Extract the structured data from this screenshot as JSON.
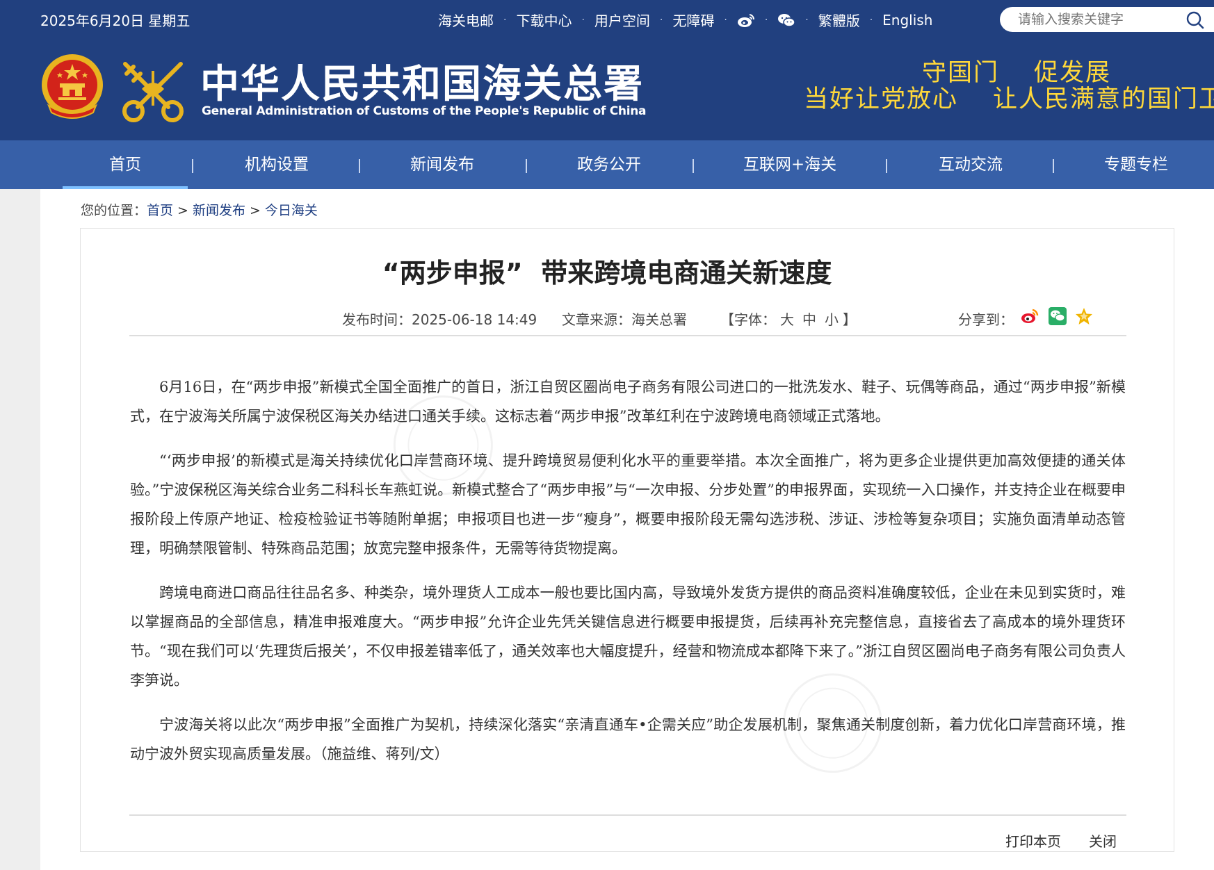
{
  "header": {
    "date": "2025年6月20日 星期五",
    "links": [
      "海关电邮",
      "下载中心",
      "用户空间",
      "无障碍"
    ],
    "link_separator": "·",
    "lang_trad": "繁體版",
    "lang_en": "English",
    "search_placeholder": "请输入搜索关键字",
    "site_name": "中华人民共和国海关总署",
    "site_name_en": "General Administration of Customs of the People's Republic of China",
    "slogan_line1": [
      "守国门",
      "促发展"
    ],
    "slogan_line2": [
      "当好让党放心",
      "让人民满意的国门卫士"
    ],
    "colors": {
      "header_bg": "#21407f",
      "nav_bg": "#3760a8",
      "slogan": "#ffd83a"
    }
  },
  "nav": {
    "items": [
      "首页",
      "机构设置",
      "新闻发布",
      "政务公开",
      "互联网+海关",
      "互动交流",
      "专题专栏"
    ],
    "active": "首页"
  },
  "breadcrumb": {
    "prefix": "您的位置：",
    "items": [
      "首页",
      "新闻发布",
      "今日海关"
    ],
    "separator": ">"
  },
  "article": {
    "title": "“两步申报”  带来跨境电商通关新速度",
    "publish_label": "发布时间：",
    "publish_time": "2025-06-18 14:49",
    "source_label": "文章来源：",
    "source": "海关总署",
    "font_label_open": "【字体：",
    "font_large": "大",
    "font_medium": "中",
    "font_small": "小",
    "font_label_close": "】",
    "share_label": "分享到：",
    "paragraphs": [
      "6月16日，在“两步申报”新模式全国全面推广的首日，浙江自贸区圈尚电子商务有限公司进口的一批洗发水、鞋子、玩偶等商品，通过“两步申报”新模式，在宁波海关所属宁波保税区海关办结进口通关手续。这标志着“两步申报”改革红利在宁波跨境电商领域正式落地。",
      "“‘两步申报’的新模式是海关持续优化口岸营商环境、提升跨境贸易便利化水平的重要举措。本次全面推广，将为更多企业提供更加高效便捷的通关体验。”宁波保税区海关综合业务二科科长车燕虹说。新模式整合了“两步申报”与“一次申报、分步处置”的申报界面，实现统一入口操作，并支持企业在概要申报阶段上传原产地证、检疫检验证书等随附单据；申报项目也进一步“瘦身”，概要申报阶段无需勾选涉税、涉证、涉检等复杂项目；实施负面清单动态管理，明确禁限管制、特殊商品范围；放宽完整申报条件，无需等待货物提离。",
      "跨境电商进口商品往往品名多、种类杂，境外理货人工成本一般也要比国内高，导致境外发货方提供的商品资料准确度较低，企业在未见到实货时，难以掌握商品的全部信息，精准申报难度大。“两步申报”允许企业先凭关键信息进行概要申报提货，后续再补充完整信息，直接省去了高成本的境外理货环节。“现在我们可以‘先理货后报关’，不仅申报差错率低了，通关效率也大幅度提升，经营和物流成本都降下来了。”浙江自贸区圈尚电子商务有限公司负责人李笋说。",
      "宁波海关将以此次“两步申报”全面推广为契机，持续深化落实“亲清直通车•企需关应”助企发展机制，聚焦通关制度创新，着力优化口岸营商环境，推动宁波外贸实现高质量发展。（施益维、蒋列/文）"
    ]
  },
  "footer": {
    "print_label": "打印本页",
    "close_label": "关闭"
  }
}
